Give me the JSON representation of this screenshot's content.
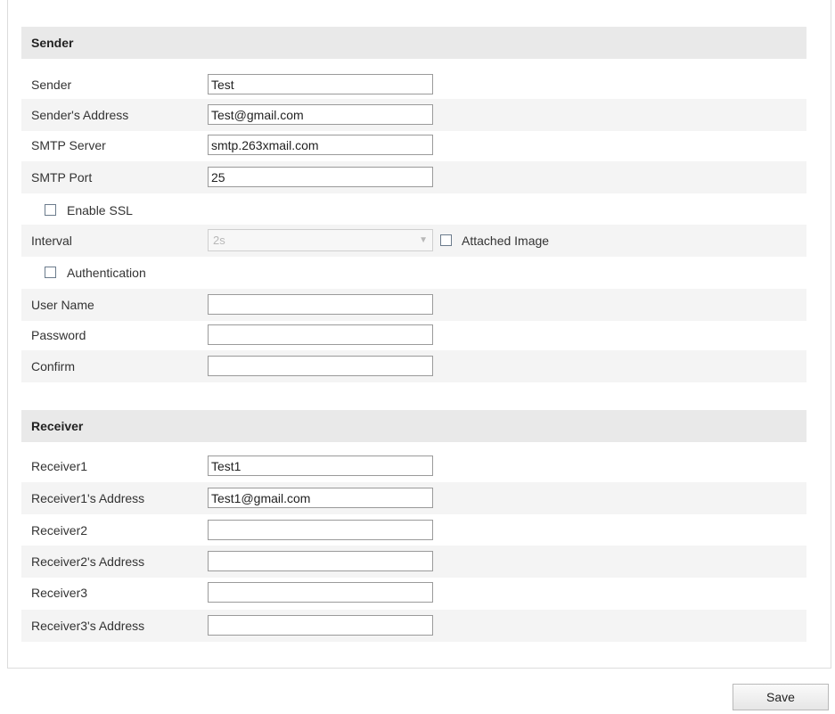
{
  "sender_section": {
    "title": "Sender",
    "sender": {
      "label": "Sender",
      "value": "Test"
    },
    "sender_address": {
      "label": "Sender's Address",
      "value": "Test@gmail.com"
    },
    "smtp_server": {
      "label": "SMTP Server",
      "value": "smtp.263xmail.com"
    },
    "smtp_port": {
      "label": "SMTP Port",
      "value": "25"
    },
    "enable_ssl": {
      "label": "Enable SSL",
      "checked": false
    },
    "interval": {
      "label": "Interval",
      "value": "2s",
      "disabled": true
    },
    "attached_image": {
      "label": "Attached Image",
      "checked": false
    },
    "authentication": {
      "label": "Authentication",
      "checked": false
    },
    "user_name": {
      "label": "User Name",
      "value": ""
    },
    "password": {
      "label": "Password",
      "value": ""
    },
    "confirm": {
      "label": "Confirm",
      "value": ""
    }
  },
  "receiver_section": {
    "title": "Receiver",
    "receivers": [
      {
        "name_label": "Receiver1",
        "name_value": "Test1",
        "address_label": "Receiver1's Address",
        "address_value": "Test1@gmail.com"
      },
      {
        "name_label": "Receiver2",
        "name_value": "",
        "address_label": "Receiver2's Address",
        "address_value": ""
      },
      {
        "name_label": "Receiver3",
        "name_value": "",
        "address_label": "Receiver3's Address",
        "address_value": ""
      }
    ]
  },
  "save_label": "Save"
}
